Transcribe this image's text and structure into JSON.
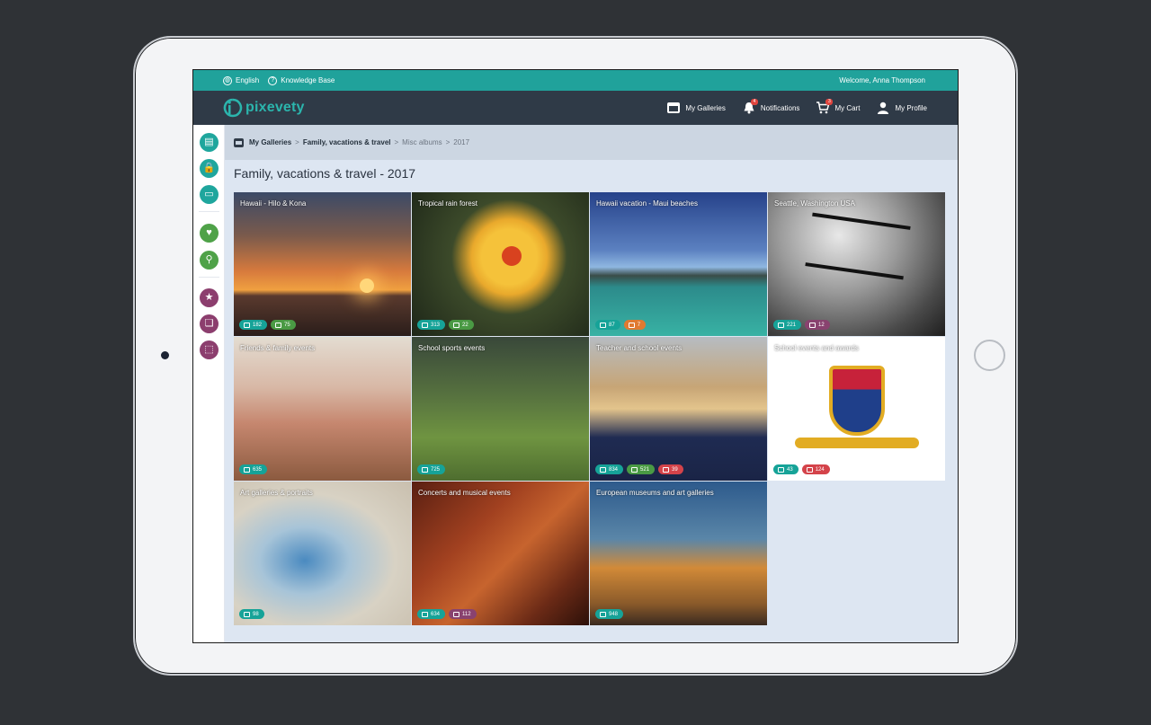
{
  "topbar": {
    "language": "English",
    "knowledge_base": "Knowledge Base",
    "welcome": "Welcome,  Anna Thompson"
  },
  "brand": {
    "logo_text": "pixevety"
  },
  "nav": {
    "my_galleries": "My Galleries",
    "notifications": "Notifications",
    "notifications_badge": "4",
    "my_cart": "My Cart",
    "cart_badge": "3",
    "my_profile": "My Profile"
  },
  "breadcrumb": {
    "items": [
      "My Galleries",
      "Family, vacations & travel",
      "Misc albums",
      "2017"
    ],
    "separator": ">"
  },
  "page": {
    "title": "Family, vacations & travel - 2017"
  },
  "albums": [
    {
      "name": "Hawaii - Hilo & Kona",
      "photos": "182",
      "videos": "75"
    },
    {
      "name": "Tropical rain forest",
      "photos": "313",
      "videos": "22"
    },
    {
      "name": "Hawaii vacation - Maui beaches",
      "photos": "87",
      "books": "7"
    },
    {
      "name": "Seattle, Washington USA",
      "photos": "221",
      "audio": "12"
    },
    {
      "name": "Friends & family events",
      "photos": "635"
    },
    {
      "name": "School sports events",
      "photos": "725"
    },
    {
      "name": "Teacher and school events",
      "photos": "834",
      "videos": "521",
      "docs": "39"
    },
    {
      "name": "School events and awards",
      "photos": "43",
      "docs": "124"
    },
    {
      "name": "Art galleries & portraits",
      "photos": "98"
    },
    {
      "name": "Concerts and musical events",
      "photos": "634",
      "audio": "112"
    },
    {
      "name": "European museums and art galleries",
      "photos": "948"
    }
  ],
  "colors": {
    "topbar": "#20a29b",
    "navbar": "#2f3a47",
    "photo_badge": "#16a398",
    "video_badge": "#4a9a44",
    "audio_badge": "#89426f",
    "doc_badge": "#d4434a",
    "book_badge": "#e07a30"
  }
}
